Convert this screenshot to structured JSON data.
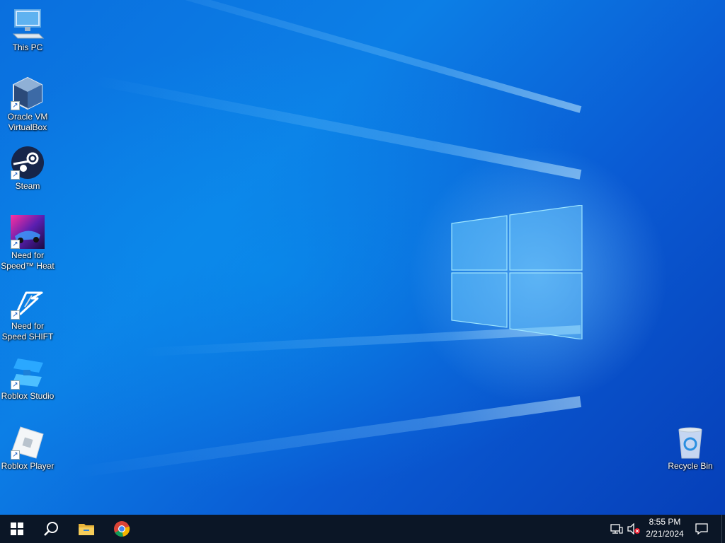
{
  "desktop": {
    "icons": [
      {
        "label_line1": "This PC",
        "label_line2": "",
        "icon": "monitor-icon",
        "shortcut": false
      },
      {
        "label_line1": "Oracle VM",
        "label_line2": "VirtualBox",
        "icon": "virtualbox-icon",
        "shortcut": true
      },
      {
        "label_line1": "Steam",
        "label_line2": "",
        "icon": "steam-icon",
        "shortcut": true
      },
      {
        "label_line1": "Need for",
        "label_line2": "Speed™ Heat",
        "icon": "nfs-heat-icon",
        "shortcut": true
      },
      {
        "label_line1": "Need for",
        "label_line2": "Speed SHIFT",
        "icon": "nfs-shift-icon",
        "shortcut": true
      },
      {
        "label_line1": "Roblox Studio",
        "label_line2": "",
        "icon": "roblox-studio-icon",
        "shortcut": true
      },
      {
        "label_line1": "Roblox Player",
        "label_line2": "",
        "icon": "roblox-player-icon",
        "shortcut": true
      },
      {
        "label_line1": "Recycle Bin",
        "label_line2": "",
        "icon": "recycle-bin-icon",
        "shortcut": false
      }
    ],
    "shortcut_glyph": "↗"
  },
  "taskbar": {
    "pinned": [
      "windows-start-icon",
      "search-icon",
      "file-explorer-icon",
      "chrome-icon"
    ],
    "tray_icons": [
      "network-icon",
      "volume-muted-icon"
    ],
    "clock": {
      "time": "8:55 PM",
      "date": "2/21/2024"
    },
    "notification_icon": "action-center-icon"
  },
  "colors": {
    "taskbar_bg": "#0b1626",
    "desktop_accent": "#0a6fde"
  }
}
